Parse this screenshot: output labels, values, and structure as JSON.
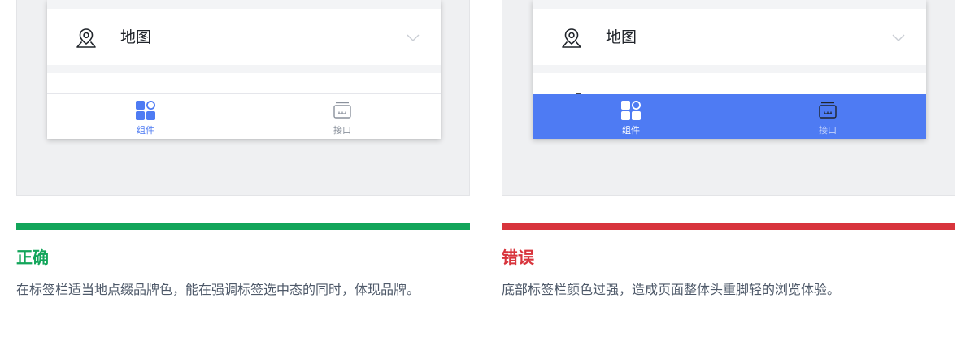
{
  "colors": {
    "correct": "#12a55a",
    "wrong": "#d8343c",
    "brand": "#4e7bf3",
    "tab_inactive": "#8a919c"
  },
  "examples": [
    {
      "verdict": "正确",
      "description": "在标签栏适当地点缀品牌色，能在强调标签选中态的同时，体现品牌。",
      "list_item_label": "地图",
      "list_item_icon": "location-pin-icon",
      "tabs": [
        {
          "label": "组件",
          "icon": "components-grid-icon",
          "selected": true
        },
        {
          "label": "接口",
          "icon": "interface-screen-icon",
          "selected": false
        }
      ]
    },
    {
      "verdict": "错误",
      "description": "底部标签栏颜色过强，造成页面整体头重脚轻的浏览体验。",
      "list_item_label": "地图",
      "list_item_icon": "location-pin-icon",
      "tabs": [
        {
          "label": "组件",
          "icon": "components-grid-icon",
          "selected": true
        },
        {
          "label": "接口",
          "icon": "interface-screen-icon",
          "selected": false
        }
      ]
    }
  ]
}
